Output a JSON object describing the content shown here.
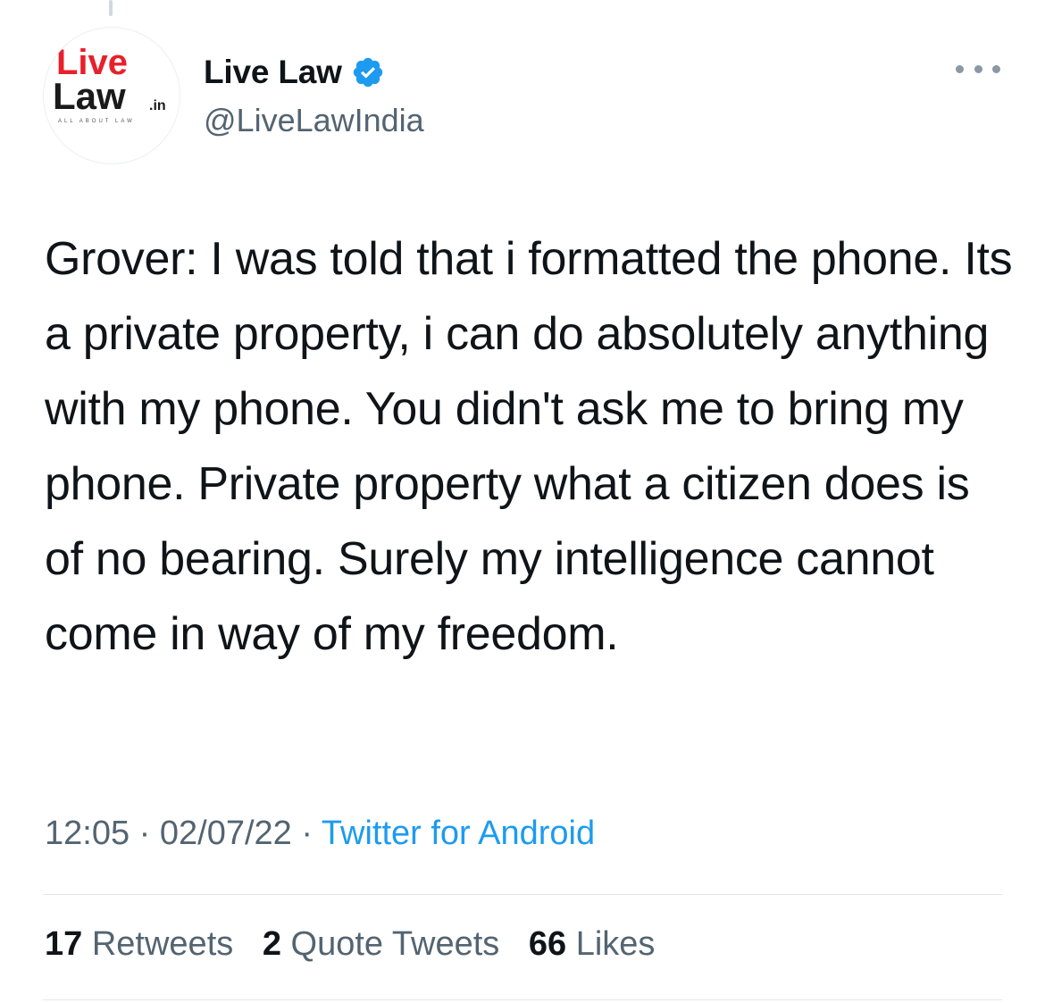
{
  "author": {
    "display_name": "Live Law",
    "handle": "@LiveLawIndia",
    "verified": true,
    "avatar_logo": {
      "line1": "Live",
      "line2": "Law",
      "suffix": ".in",
      "tagline": "ALL ABOUT LAW"
    }
  },
  "more_icon": "more-horizontal-icon",
  "tweet": {
    "text": "Grover: I was told that i formatted the phone. Its a private property, i can do absolutely anything with my phone. You didn't ask me to bring my phone. Private property what a citizen does is of no bearing. Surely my intelligence cannot come in way of my freedom."
  },
  "meta": {
    "time": "12:05",
    "separator": " · ",
    "date": "02/07/22",
    "source": "Twitter for Android"
  },
  "stats": {
    "retweets_count": "17",
    "retweets_label": "Retweets",
    "quotes_count": "2",
    "quotes_label": "Quote Tweets",
    "likes_count": "66",
    "likes_label": "Likes"
  },
  "colors": {
    "brand_red": "#e8202a",
    "link_blue": "#1d9bf0",
    "muted_text": "#536471",
    "primary_text": "#0f1419"
  }
}
